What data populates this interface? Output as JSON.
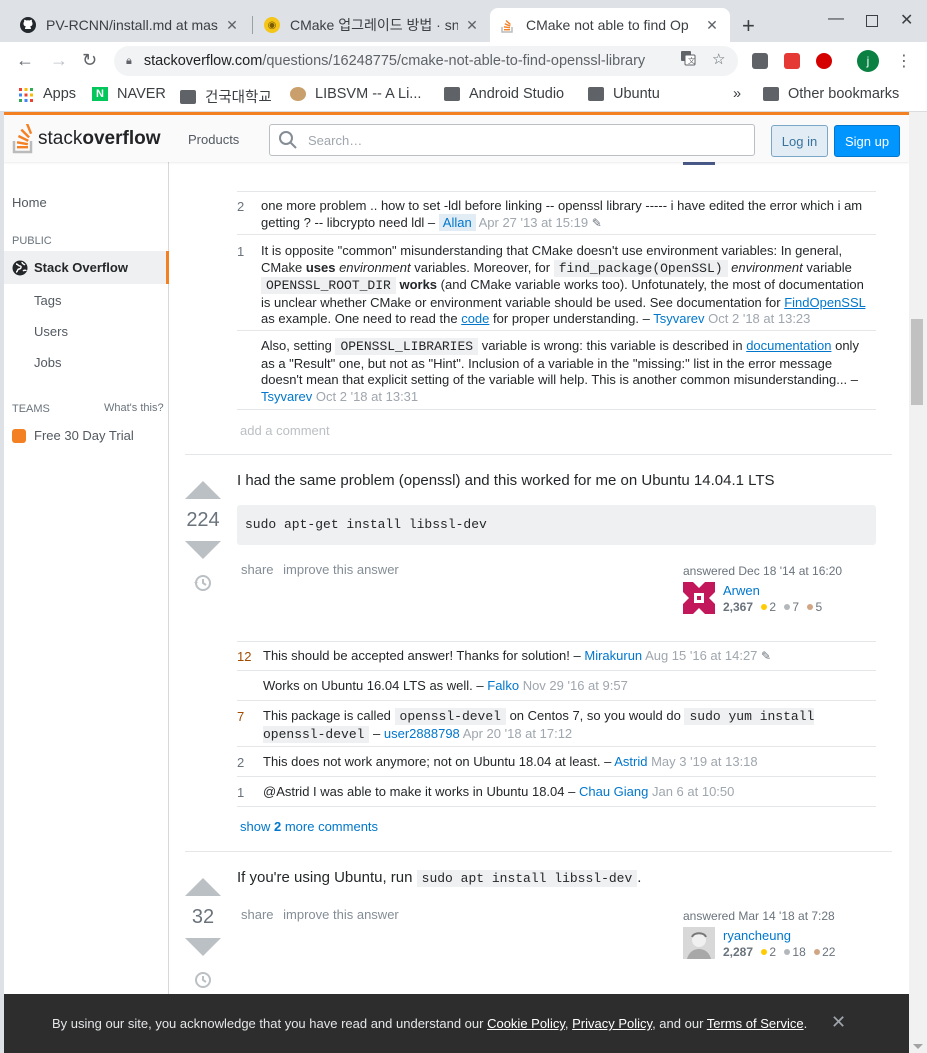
{
  "browser": {
    "tabs": [
      {
        "title": "PV-RCNN/install.md at master",
        "favicon": "github-icon"
      },
      {
        "title": "CMake 업그레이드 방법 · sn",
        "favicon": "site-icon"
      },
      {
        "title": "CMake not able to find Op",
        "favicon": "stackoverflow-icon",
        "active": true
      }
    ],
    "new_tab": "+",
    "url_host": "stackoverflow.com",
    "url_path": "/questions/16248775/cmake-not-able-to-find-openssl-library",
    "profile_initial": "j",
    "bookmarks": [
      {
        "label": "Apps",
        "icon": "apps-grid-icon"
      },
      {
        "label": "NAVER",
        "icon": "naver-icon"
      },
      {
        "label": "건국대학교",
        "icon": "folder-icon"
      },
      {
        "label": "LIBSVM -- A Li...",
        "icon": "libsvm-icon"
      },
      {
        "label": "Android Studio",
        "icon": "folder-icon"
      },
      {
        "label": "Ubuntu",
        "icon": "folder-icon"
      }
    ],
    "bookmarks_overflow": "»",
    "other_bookmarks": "Other bookmarks"
  },
  "so": {
    "logo_light": "stack",
    "logo_bold": "overflow",
    "products": "Products",
    "search_placeholder": "Search…",
    "login": "Log in",
    "signup": "Sign up"
  },
  "leftnav": {
    "home": "Home",
    "public": "PUBLIC",
    "stack_overflow": "Stack Overflow",
    "tags": "Tags",
    "users": "Users",
    "jobs": "Jobs",
    "teams": "TEAMS",
    "whats_this": "What's this?",
    "trial": "Free 30 Day Trial"
  },
  "question_comments": {
    "c1": {
      "score": "2",
      "text": "one more problem .. how to set -ldl before linking -- openssl library ----- i have edited the error which i am getting ? -- libcrypto need ldl –",
      "user": "Allan",
      "date": "Apr 27 '13 at 15:19"
    },
    "c2": {
      "score": "1",
      "p1": "It is opposite \"common\" misunderstanding that CMake doesn't use environment variables: In general, CMake",
      "uses": "uses",
      "env1": "environment",
      "p2": "variables. Moreover, for",
      "code1": "find_package(OpenSSL)",
      "env2": "environment",
      "p3": "variable",
      "code2": "OPENSSL_ROOT_DIR",
      "works": "works",
      "p4": "(and CMake variable works too). Unfotunately, the most of documentation is unclear whether CMake or environment variable should be used. See documentation for",
      "link1": "FindOpenSSL",
      "p5": "as example. One need to read the",
      "link2": "code",
      "p6": "for proper understanding. –",
      "user": "Tsyvarev",
      "date": "Oct 2 '18 at 13:23"
    },
    "c3": {
      "p1": "Also, setting",
      "code1": "OPENSSL_LIBRARIES",
      "p2": "variable is wrong: this variable is described in",
      "link1": "documentation",
      "p3": "only as a \"Result\" one, but not as \"Hint\". Inclusion of a variable in the \"missing:\" list in the error message doesn't mean that explicit setting of the variable will help. This is another common misunderstanding... –",
      "user": "Tsyvarev",
      "date": "Oct 2 '18 at 13:31"
    },
    "add_comment": "add a comment"
  },
  "answer1": {
    "votes": "224",
    "text": "I had the same problem (openssl) and this worked for me on Ubuntu 14.04.1 LTS",
    "code": "sudo apt-get install libssl-dev",
    "share": "share",
    "improve": "improve this answer",
    "answered": "answered Dec 18 '14 at 16:20",
    "user": "Arwen",
    "rep": "2,367",
    "gold": "2",
    "silver": "7",
    "bronze": "5",
    "comments": {
      "c1": {
        "score": "12",
        "text": "This should be accepted answer! Thanks for solution! –",
        "user": "Mirakurun",
        "date": "Aug 15 '16 at 14:27"
      },
      "c2": {
        "score": "",
        "text": "Works on Ubuntu 16.04 LTS as well. –",
        "user": "Falko",
        "date": "Nov 29 '16 at 9:57"
      },
      "c3": {
        "score": "7",
        "p1": "This package is called",
        "code1": "openssl-devel",
        "p2": "on Centos 7, so you would do",
        "code2": "sudo yum install openssl-devel",
        "user": "user2888798",
        "date": "Apr 20 '18 at 17:12"
      },
      "c4": {
        "score": "2",
        "text": "This does not work anymore; not on Ubuntu 18.04 at least. –",
        "user": "Astrid",
        "date": "May 3 '19 at 13:18"
      },
      "c5": {
        "score": "1",
        "text": "@Astrid I was able to make it works in Ubuntu 18.04 –",
        "user": "Chau Giang",
        "date": "Jan 6 at 10:50"
      }
    },
    "show_more_prefix": "show",
    "show_more_count": "2",
    "show_more_suffix": "more comments"
  },
  "answer2": {
    "votes": "32",
    "text_pre": "If you're using Ubuntu, run",
    "code": "sudo apt install libssl-dev",
    "text_post": ".",
    "share": "share",
    "improve": "improve this answer",
    "answered": "answered Mar 14 '18 at 7:28",
    "user": "ryancheung",
    "rep": "2,287",
    "gold": "2",
    "silver": "18",
    "bronze": "22"
  },
  "cookie": {
    "p1": "By using our site, you acknowledge that you have read and understand our",
    "cookie_policy": "Cookie Policy",
    "sep": ",",
    "privacy_policy": "Privacy Policy",
    "p2": ", and our",
    "terms": "Terms of Service",
    "p3": ".",
    "close": "✕"
  },
  "colors": {
    "accent": "#f48024",
    "link": "#0077cc",
    "gold": "#ffcc01",
    "silver": "#b4b8bc",
    "bronze": "#d1a684"
  }
}
